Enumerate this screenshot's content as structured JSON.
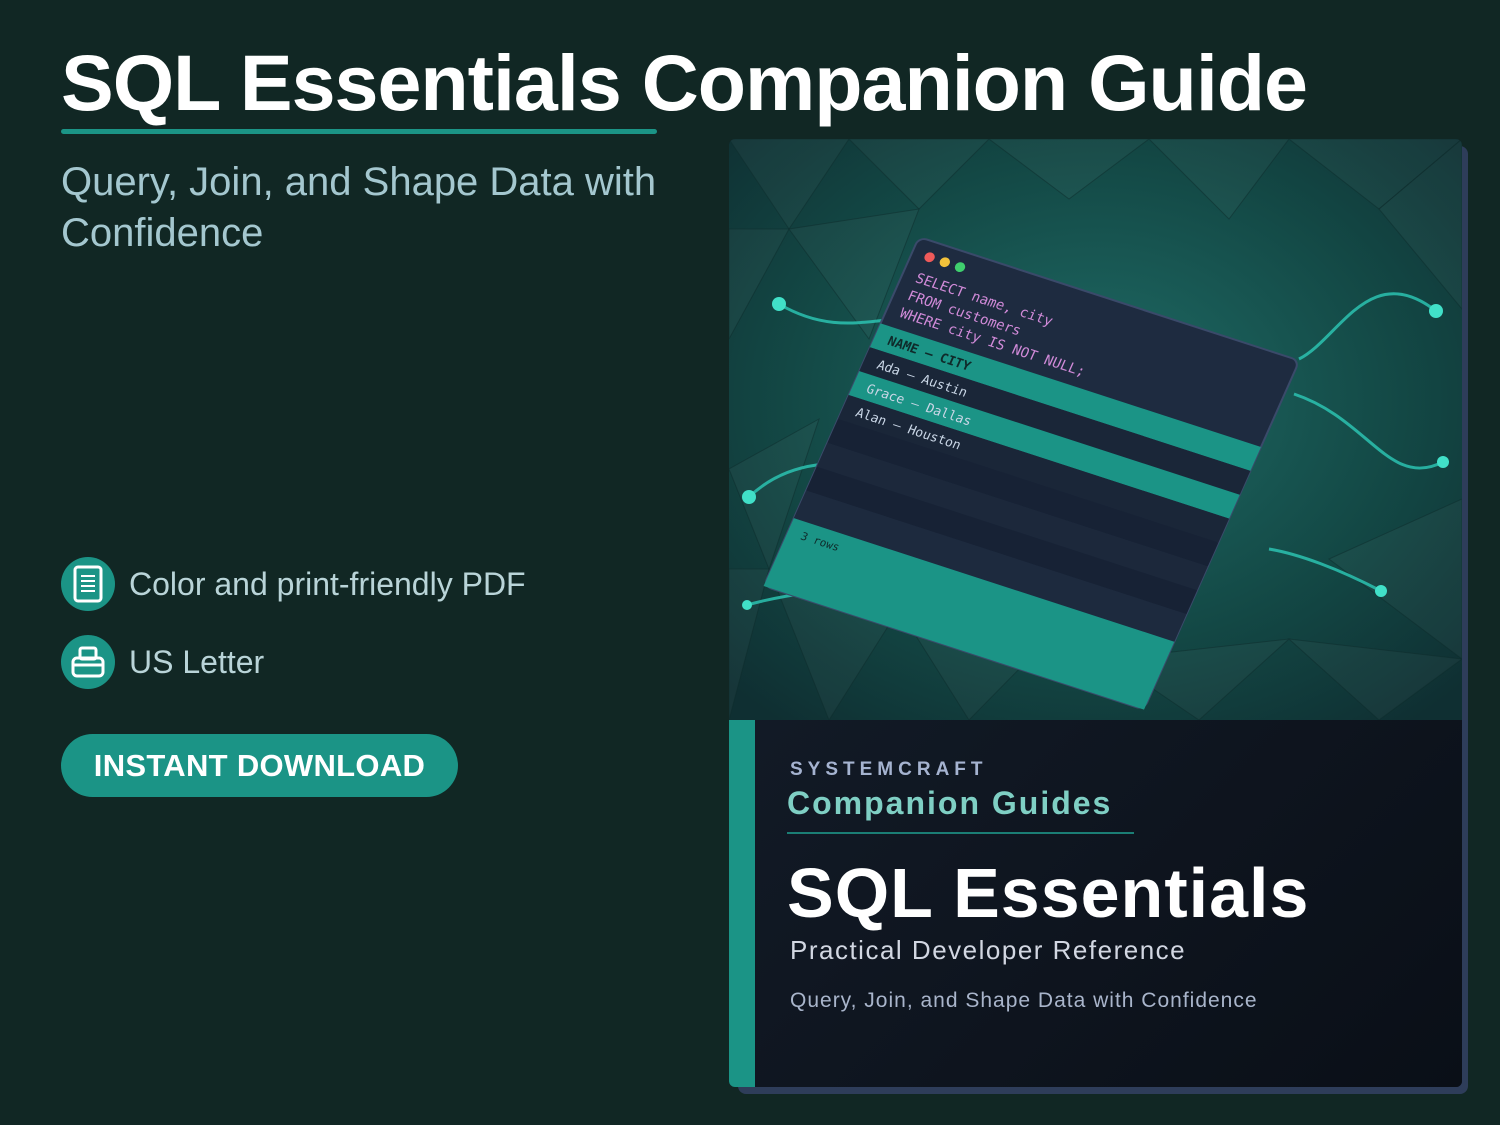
{
  "header": {
    "title": "SQL Essentials Companion Guide",
    "subtitle": "Query, Join, and Shape Data with Confidence"
  },
  "features": [
    {
      "icon": "document-icon",
      "label": "Color and print-friendly PDF"
    },
    {
      "icon": "printer-icon",
      "label": "US Letter"
    }
  ],
  "cta": {
    "label": "INSTANT DOWNLOAD"
  },
  "cover": {
    "publisher": "SYSTEMCRAFT",
    "series": "Companion Guides",
    "title": "SQL Essentials",
    "subtitle": "Practical Developer Reference",
    "tagline": "Query, Join, and Shape Data with Confidence",
    "code": {
      "lines": [
        "SELECT name, city",
        "FROM customers",
        "WHERE city IS NOT NULL;"
      ],
      "header_row": "NAME – CITY",
      "rows": [
        "Ada – Austin",
        "Grace – Dallas",
        "Alan – Houston"
      ],
      "footer": "3 rows"
    }
  },
  "colors": {
    "background": "#112724",
    "accent": "#1b9486",
    "subtitle_text": "#a4c7cf",
    "cover_dark": "#0b121b",
    "series_text": "#7fcfc4"
  }
}
